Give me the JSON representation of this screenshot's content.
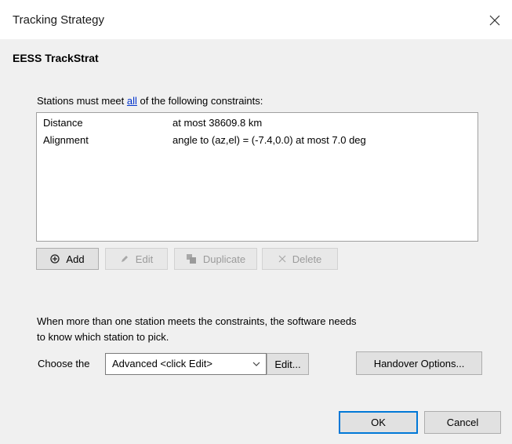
{
  "window": {
    "title": "Tracking Strategy"
  },
  "heading": "EESS TrackStrat",
  "constraints": {
    "label_prefix": "Stations must meet ",
    "label_link": "all",
    "label_suffix": " of the following constraints:",
    "rows": [
      {
        "name": "Distance",
        "value": "at most 38609.8 km"
      },
      {
        "name": "Alignment",
        "value": "angle to (az,el) = (-7.4,0.0) at most 7.0 deg"
      }
    ]
  },
  "toolbar": {
    "add": {
      "label": "Add",
      "icon": "plus-icon",
      "enabled": true
    },
    "edit": {
      "label": "Edit",
      "icon": "pencil-icon",
      "enabled": false
    },
    "duplicate": {
      "label": "Duplicate",
      "icon": "duplicate-icon",
      "enabled": false
    },
    "delete": {
      "label": "Delete",
      "icon": "x-icon",
      "enabled": false
    }
  },
  "info": {
    "line1": "When more than one station meets the constraints, the software needs",
    "line2": "to know which station to pick."
  },
  "choose": {
    "label": "Choose the",
    "selected": "Advanced <click Edit>",
    "edit_button": "Edit...",
    "handover_button": "Handover Options..."
  },
  "footer": {
    "ok": "OK",
    "cancel": "Cancel"
  },
  "colors": {
    "link": "#0033cc",
    "default_button_border": "#0078d7",
    "dialog_bg": "#f0f0f0"
  }
}
